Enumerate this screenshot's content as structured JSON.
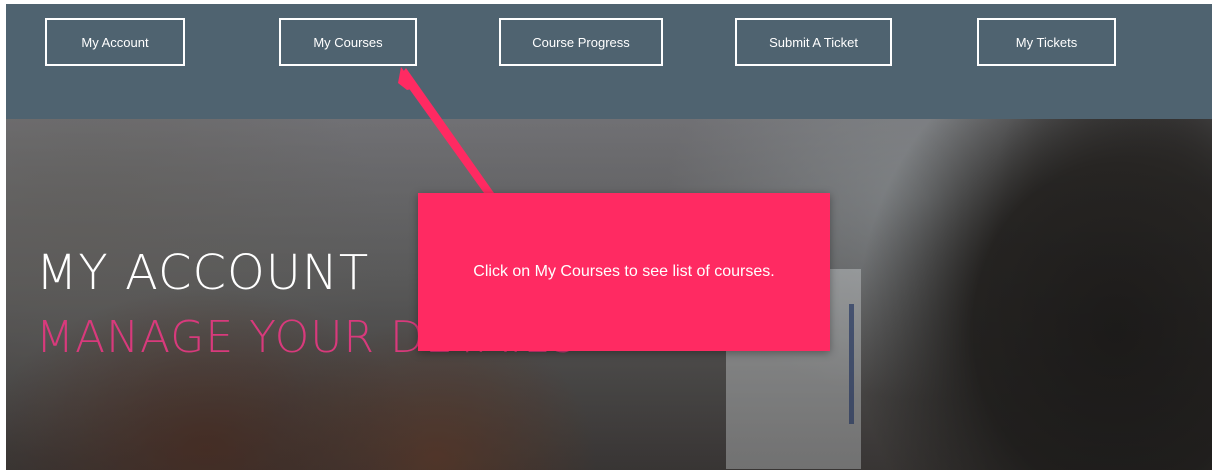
{
  "nav": {
    "items": [
      {
        "label": "My Account"
      },
      {
        "label": "My Courses"
      },
      {
        "label": "Course Progress"
      },
      {
        "label": "Submit A Ticket"
      },
      {
        "label": "My Tickets"
      }
    ]
  },
  "hero": {
    "title": "MY ACCOUNT",
    "subtitle": "MANAGE YOUR DETAILS"
  },
  "tooltip": {
    "text": "Click on My Courses to see list of courses."
  },
  "colors": {
    "navbar": "#4f6370",
    "tooltip": "#ff2a62",
    "subtitle": "#d83a7c"
  }
}
